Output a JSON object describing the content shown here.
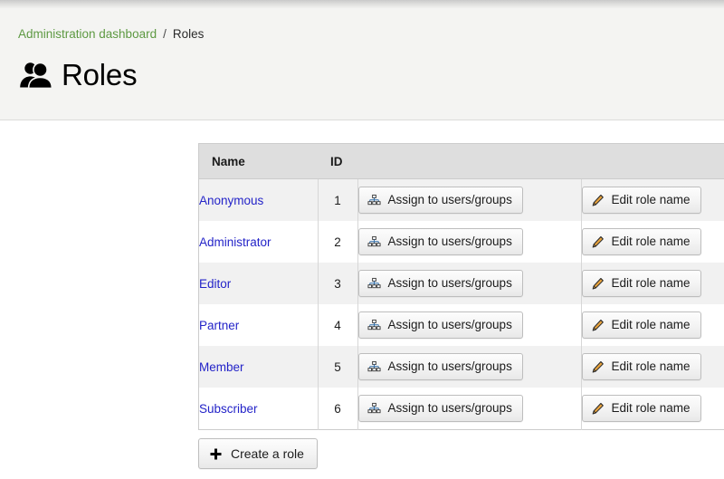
{
  "breadcrumb": {
    "root_label": "Administration dashboard",
    "separator": "/",
    "current_label": "Roles"
  },
  "page": {
    "title": "Roles",
    "title_icon": "users-icon"
  },
  "table": {
    "columns": [
      {
        "key": "name",
        "label": "Name"
      },
      {
        "key": "id",
        "label": "ID"
      },
      {
        "key": "assign",
        "label": ""
      },
      {
        "key": "edit",
        "label": ""
      }
    ],
    "rows": [
      {
        "name": "Anonymous",
        "id": "1",
        "assign_label": "Assign to users/groups",
        "edit_label": "Edit role name"
      },
      {
        "name": "Administrator",
        "id": "2",
        "assign_label": "Assign to users/groups",
        "edit_label": "Edit role name"
      },
      {
        "name": "Editor",
        "id": "3",
        "assign_label": "Assign to users/groups",
        "edit_label": "Edit role name"
      },
      {
        "name": "Partner",
        "id": "4",
        "assign_label": "Assign to users/groups",
        "edit_label": "Edit role name"
      },
      {
        "name": "Member",
        "id": "5",
        "assign_label": "Assign to users/groups",
        "edit_label": "Edit role name"
      },
      {
        "name": "Subscriber",
        "id": "6",
        "assign_label": "Assign to users/groups",
        "edit_label": "Edit role name"
      }
    ]
  },
  "icons": {
    "assign": "org-chart-icon",
    "edit": "pencil-icon",
    "create": "plus-icon"
  },
  "actions": {
    "create_label": "Create a role"
  },
  "colors": {
    "breadcrumb_link": "#5d9942",
    "role_link": "#2323c8",
    "header_band": "#f4f4f2",
    "table_header": "#dedede",
    "row_odd": "#f1f1f1",
    "row_even": "#ffffff",
    "button_border": "#bdbdbd"
  }
}
